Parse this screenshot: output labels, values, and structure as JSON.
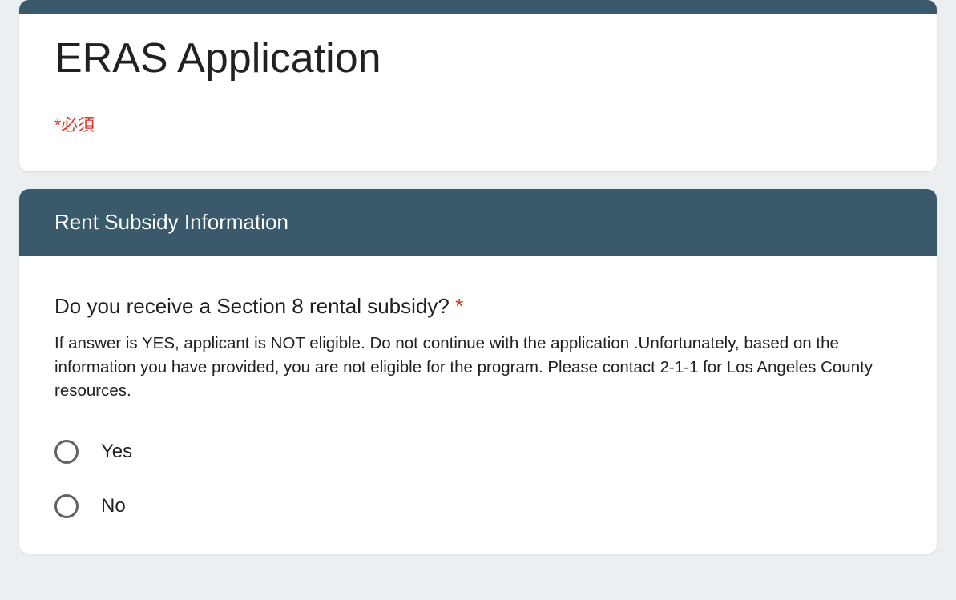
{
  "header": {
    "title": "ERAS Application",
    "required_note": "*必須"
  },
  "section": {
    "banner": "Rent Subsidy Information",
    "question": {
      "title": "Do you receive a Section 8 rental subsidy?",
      "asterisk": "*",
      "description": "If answer is YES, applicant is NOT eligible. Do not continue with the application .Unfortunately, based on the information you have provided, you are not eligible for the program. Please contact 2-1-1 for Los Angeles County resources.",
      "options": [
        "Yes",
        "No"
      ]
    }
  }
}
